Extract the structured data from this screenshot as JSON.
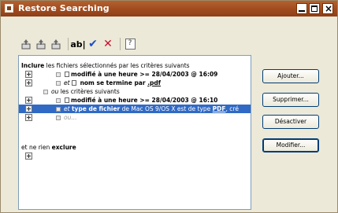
{
  "window": {
    "title": "Restore Searching"
  },
  "toolbar": {
    "icons": [
      "upload-icon",
      "upload-icon",
      "upload-icon",
      "abl-text-icon",
      "check-icon",
      "cross-icon",
      "help-icon"
    ],
    "abl_label": "ab|",
    "help_label": "?"
  },
  "criteria": {
    "line1": {
      "b": "Inclure",
      "t": " les fichiers sélectionnés par les critères suivants"
    },
    "line2": {
      "t": "modifié à une heure >= 28/04/2003 @ 16:09"
    },
    "line3": {
      "it": "et",
      "t1": " nom se termine par ",
      "u": ".pdf"
    },
    "line4": {
      "it": "ou",
      "t": " les critères suivants"
    },
    "line5": {
      "t": "modifié à une heure >= 28/04/2003 @ 16:10"
    },
    "line6": {
      "it": "et",
      "b": "type de fichier",
      "t1": " de Mac OS 9/OS X  est de type ",
      "u": "PDF",
      "t2": ", cré"
    },
    "line7": {
      "it": "ou..."
    },
    "line8": {
      "t1": "et ne rien ",
      "b": "exclure"
    }
  },
  "buttons": {
    "ajouter": "Ajouter...",
    "supprimer": "Supprimer...",
    "desactiver": "Désactiver",
    "modifier": "Modifier..."
  }
}
